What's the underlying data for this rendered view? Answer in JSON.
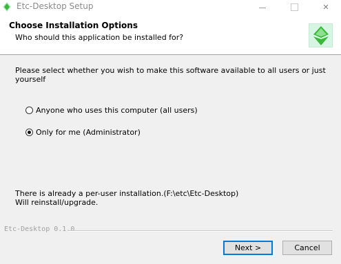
{
  "window": {
    "title": "Etc-Desktop Setup",
    "close_glyph": "✕",
    "icons": [
      "app-icon",
      "minimize-icon",
      "maximize-icon",
      "close-icon"
    ]
  },
  "header": {
    "title": "Choose Installation Options",
    "subtitle": "Who should this application be installed for?",
    "logo_icon": "ethereum-classic-logo-icon"
  },
  "content": {
    "prompt": "Please select whether you wish to make this software available to all users or just yourself",
    "options": [
      {
        "label": "Anyone who uses this computer (all users)",
        "selected": false
      },
      {
        "label": "Only for me (Administrator)",
        "selected": true
      }
    ],
    "notice_line1": "There is already a per-user installation.(F:\\etc\\Etc-Desktop)",
    "notice_line2": "Will reinstall/upgrade."
  },
  "footer": {
    "branding": "Etc-Desktop 0.1.0",
    "next_label": "Next >",
    "cancel_label": "Cancel"
  },
  "colors": {
    "accent": "#0078d7",
    "logo_bg": "#d6f5e3",
    "logo_green": "#3ab83a"
  }
}
